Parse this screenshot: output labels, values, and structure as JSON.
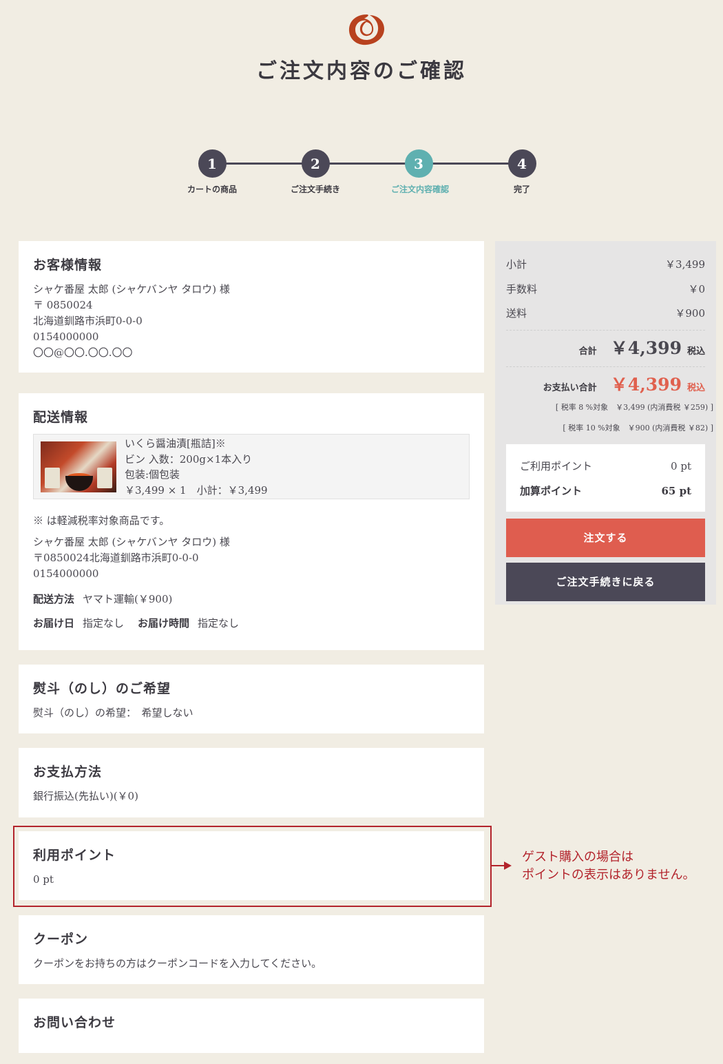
{
  "header": {
    "title": "ご注文内容のご確認"
  },
  "stepper": [
    {
      "num": "1",
      "label": "カートの商品"
    },
    {
      "num": "2",
      "label": "ご注文手続き"
    },
    {
      "num": "3",
      "label": "ご注文内容確認"
    },
    {
      "num": "4",
      "label": "完了"
    }
  ],
  "customer": {
    "title": "お客様情報",
    "name": "シャケ番屋 太郎 (シャケバンヤ タロウ) 様",
    "postal": "〒 0850024",
    "address": "北海道釧路市浜町0-0-0",
    "phone": "0154000000",
    "email": "〇〇@〇〇.〇〇.〇〇"
  },
  "shipping": {
    "title": "配送情報",
    "item": {
      "name": "いくら醤油漬[瓶詰]※",
      "spec": "ビン 入数：200g×1本入り",
      "wrap": "包装:個包装",
      "price_line": "￥3,499 × 1　小計：￥3,499"
    },
    "note": "※ は軽減税率対象商品です。",
    "recipient": "シャケ番屋 太郎 (シャケバンヤ タロウ) 様",
    "recipient_address": "〒0850024北海道釧路市浜町0-0-0",
    "recipient_phone": "0154000000",
    "method_label": "配送方法",
    "method_value": "ヤマト運輸(￥900)",
    "date_label": "お届け日",
    "date_value": "指定なし",
    "time_label": "お届け時間",
    "time_value": "指定なし"
  },
  "noshi": {
    "title": "熨斗（のし）のご希望",
    "text": "熨斗（のし）の希望：　希望しない"
  },
  "payment": {
    "title": "お支払方法",
    "text": "銀行振込(先払い)(￥0)"
  },
  "points": {
    "title": "利用ポイント",
    "text": "0 pt"
  },
  "coupon": {
    "title": "クーポン",
    "text": "クーポンをお持ちの方はクーポンコードを入力してください。"
  },
  "inquiry": {
    "title": "お問い合わせ"
  },
  "guest_note": {
    "line1": "ゲスト購入の場合は",
    "line2": "ポイントの表示はありません。"
  },
  "summary": {
    "subtotal_label": "小計",
    "subtotal": "￥3,499",
    "fee_label": "手数料",
    "fee": "￥0",
    "shipping_label": "送料",
    "shipping": "￥900",
    "total_label": "合計",
    "total": "￥4,399",
    "total_tax": "税込",
    "pay_label": "お支払い合計",
    "pay_total": "￥4,399",
    "pay_tax": "税込",
    "tax8": "[ 税率 8 %対象　￥3,499 (内消費税 ￥259) ]",
    "tax10": "[ 税率 10 %対象　￥900 (内消費税 ￥82) ]",
    "use_points_label": "ご利用ポイント",
    "use_points": "0 pt",
    "add_points_label": "加算ポイント",
    "add_points": "65 pt",
    "order_button": "注文する",
    "back_button": "ご注文手続きに戻る"
  },
  "colors": {
    "accent_red": "#df5d4f",
    "dark": "#4b4857",
    "teal": "#5fb0b0",
    "alert_red": "#b3242c"
  }
}
